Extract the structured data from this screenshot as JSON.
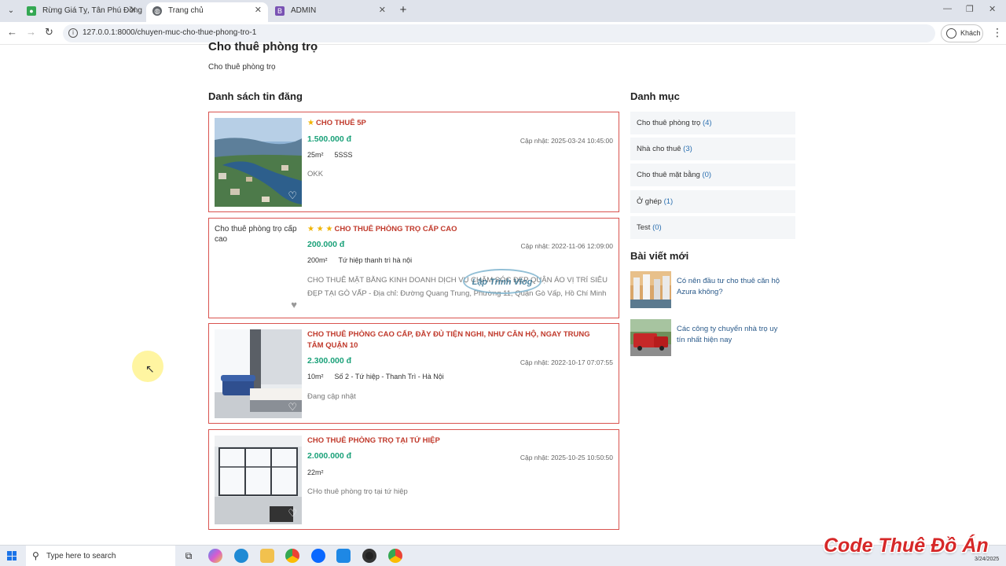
{
  "browser": {
    "tabs": [
      {
        "title": "Rừng Giá Tỵ, Tân Phú Đồng Nai",
        "icon": "map-pin-icon",
        "color": "#34a853"
      },
      {
        "title": "Trang chủ",
        "icon": "globe-icon",
        "color": "#5f6368"
      },
      {
        "title": "ADMIN",
        "icon": "bootstrap-icon",
        "color": "#7952b3"
      }
    ],
    "url": "127.0.0.1:8000/chuyen-muc-cho-thue-phong-tro-1",
    "profile_label": "Khách"
  },
  "page": {
    "title": "Cho thuê phòng trọ",
    "description": "Cho thuê phòng trọ",
    "listings_heading": "Danh sách tin đăng"
  },
  "listings": [
    {
      "stars": "★",
      "title": "CHO THUÊ 5P",
      "price": "1.500.000 đ",
      "updated": "Cập nhật: 2025-03-24 10:45:00",
      "area": "25m²",
      "address": "5SSS",
      "description": "OKK",
      "image": "aerial-city-photo"
    },
    {
      "stars": "★ ★ ★",
      "title": "CHO THUÊ PHÒNG TRỌ CẤP CAO",
      "price": "200.000 đ",
      "updated": "Cập nhật: 2022-11-06 12:09:00",
      "area": "200m²",
      "address": "Tứ hiệp thanh trì hà nội",
      "description": "CHO THUÊ MẶT BẰNG KINH DOANH DỊCH VỤ CHĂM SÓC ĐẸP QUẬN ÁO VỊ TRÍ SIÊU ĐẸP TẠI GÒ VẤP - Địa chỉ: Đường Quang Trung, Phường 11, Quận Gò Vấp, Hồ Chí Minh",
      "image_alt": "Cho thuê phòng trọ cấp cao"
    },
    {
      "stars": "",
      "title": "CHO THUÊ PHÒNG CAO CẤP, ĐẦY ĐỦ TIỆN NGHI, NHƯ CĂN HỘ, NGAY TRUNG TÂM QUẬN 10",
      "price": "2.300.000 đ",
      "updated": "Cập nhật: 2022-10-17 07:07:55",
      "area": "10m²",
      "address": "Số 2 - Tứ hiệp - Thanh Trì - Hà Nội",
      "description": "Đang cập nhật",
      "image": "bedroom-photo"
    },
    {
      "stars": "",
      "title": "CHO THUÊ PHÒNG TRỌ TẠI TỨ HIỆP",
      "price": "2.000.000 đ",
      "updated": "Cập nhật: 2025-10-25 10:50:50",
      "area": "22m²",
      "address": "",
      "description": "CHo thuê phòng trọ tại tứ hiệp",
      "image": "empty-room-photo"
    }
  ],
  "sidebar": {
    "categories_heading": "Danh mục",
    "categories": [
      {
        "name": "Cho thuê phòng trọ",
        "count": "(4)"
      },
      {
        "name": "Nhà cho thuê",
        "count": "(3)"
      },
      {
        "name": "Cho thuê mặt bằng",
        "count": "(0)"
      },
      {
        "name": "Ở ghép",
        "count": "(1)"
      },
      {
        "name": "Test",
        "count": "(0)"
      }
    ],
    "posts_heading": "Bài viết mới",
    "posts": [
      {
        "title": "Có nên đầu tư cho thuê căn hộ Azura không?"
      },
      {
        "title": "Các công ty chuyển nhà trọ uy tín nhất hiện nay"
      }
    ]
  },
  "overlay": {
    "watermark": "Lập Trình Vlog",
    "brand": "Code Thuê Đồ Án",
    "date": "3/24/2025"
  },
  "taskbar": {
    "search_placeholder": "Type here to search"
  }
}
